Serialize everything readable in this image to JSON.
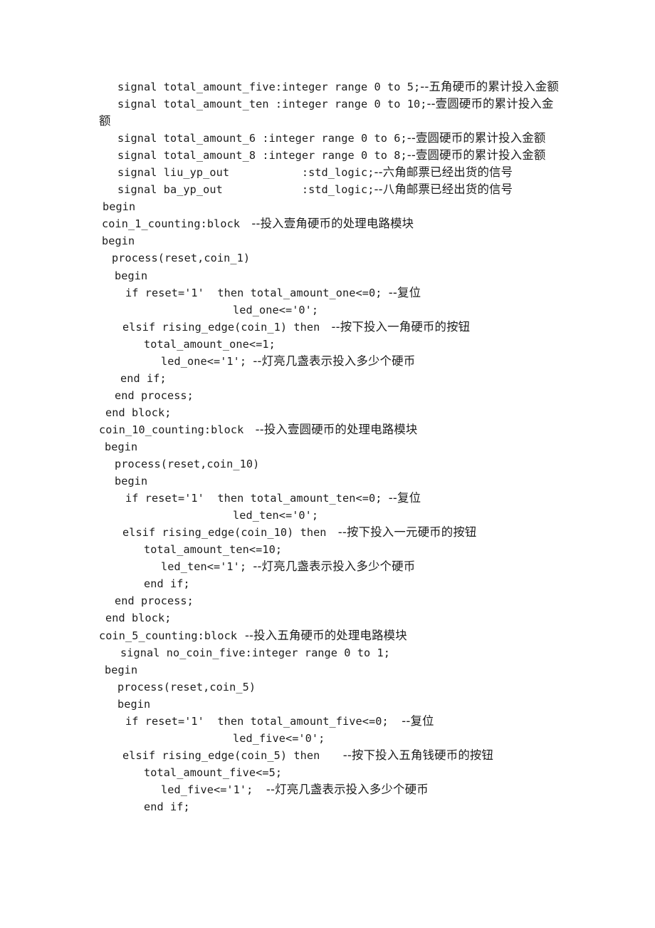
{
  "document": {
    "kind": "vhdl-source-listing",
    "page_background": "#ffffff",
    "text_color": "#1c1c1c",
    "lines": [
      {
        "indent": 26,
        "code": "signal total_amount_five:integer range 0 to 5;",
        "comment": "--五角硬币的累计投入金额"
      },
      {
        "indent": 26,
        "code": "signal total_amount_ten :integer range 0 to 10;",
        "comment": "--壹圆硬币的累计投入金额"
      },
      {
        "indent": 26,
        "code": "signal total_amount_6 :integer range 0 to 6;",
        "comment": "--壹圆硬币的累计投入金额"
      },
      {
        "indent": 26,
        "code": "signal total_amount_8 :integer range 0 to 8;",
        "comment": "--壹圆硬币的累计投入金额"
      },
      {
        "indent": 26,
        "code": "signal liu_yp_out           :std_logic;",
        "comment": "--六角邮票已经出货的信号"
      },
      {
        "indent": 26,
        "code": "signal ba_yp_out            :std_logic;",
        "comment": "--八角邮票已经出货的信号"
      },
      {
        "indent": 5,
        "code": "begin",
        "comment": ""
      },
      {
        "indent": 4,
        "code": "coin_1_counting:block",
        "comment": "   --投入壹角硬币的处理电路模块"
      },
      {
        "indent": 4,
        "code": "begin",
        "comment": ""
      },
      {
        "indent": 18,
        "code": "process(reset,coin_1)",
        "comment": ""
      },
      {
        "indent": 22,
        "code": "begin",
        "comment": ""
      },
      {
        "indent": 37,
        "code": "if reset='1'  then total_amount_one<=0; ",
        "comment": "--复位"
      },
      {
        "indent": 188,
        "code": "led_one<='0';",
        "comment": ""
      },
      {
        "indent": 33,
        "code": "elsif rising_edge(coin_1) then",
        "comment": "   --按下投入一角硬币的按钮"
      },
      {
        "indent": 63,
        "code": "total_amount_one<=1;",
        "comment": ""
      },
      {
        "indent": 87,
        "code": "led_one<='1'; ",
        "comment": "--灯亮几盏表示投入多少个硬币"
      },
      {
        "indent": 30,
        "code": "end if;",
        "comment": ""
      },
      {
        "indent": 22,
        "code": "end process;",
        "comment": ""
      },
      {
        "indent": 9,
        "code": "end block;",
        "comment": ""
      },
      {
        "indent": 0,
        "code": "coin_10_counting:block",
        "comment": "   --投入壹圆硬币的处理电路模块"
      },
      {
        "indent": 8,
        "code": "begin",
        "comment": ""
      },
      {
        "indent": 22,
        "code": "process(reset,coin_10)",
        "comment": ""
      },
      {
        "indent": 22,
        "code": "begin",
        "comment": ""
      },
      {
        "indent": 37,
        "code": "if reset='1'  then total_amount_ten<=0; ",
        "comment": "--复位"
      },
      {
        "indent": 188,
        "code": "led_ten<='0';",
        "comment": ""
      },
      {
        "indent": 33,
        "code": "elsif rising_edge(coin_10) then",
        "comment": "   --按下投入一元硬币的按钮"
      },
      {
        "indent": 63,
        "code": "total_amount_ten<=10;",
        "comment": ""
      },
      {
        "indent": 87,
        "code": "led_ten<='1'; ",
        "comment": "--灯亮几盏表示投入多少个硬币"
      },
      {
        "indent": 63,
        "code": "end if;",
        "comment": ""
      },
      {
        "indent": 22,
        "code": "end process;",
        "comment": ""
      },
      {
        "indent": 9,
        "code": "end block;",
        "comment": ""
      },
      {
        "indent": 0,
        "code": "coin_5_counting:block",
        "comment": "  --投入五角硬币的处理电路模块"
      },
      {
        "indent": 30,
        "code": "signal no_coin_five:integer range 0 to 1;",
        "comment": ""
      },
      {
        "indent": 8,
        "code": "begin",
        "comment": ""
      },
      {
        "indent": 26,
        "code": "process(reset,coin_5)",
        "comment": ""
      },
      {
        "indent": 26,
        "code": "begin",
        "comment": ""
      },
      {
        "indent": 37,
        "code": "if reset='1'  then total_amount_five<=0;  ",
        "comment": "--复位"
      },
      {
        "indent": 188,
        "code": "led_five<='0';",
        "comment": ""
      },
      {
        "indent": 33,
        "code": "elsif rising_edge(coin_5) then",
        "comment": "      --按下投入五角钱硬币的按钮"
      },
      {
        "indent": 63,
        "code": "total_amount_five<=5;",
        "comment": ""
      },
      {
        "indent": 87,
        "code": "led_five<='1';  ",
        "comment": "--灯亮几盏表示投入多少个硬币"
      },
      {
        "indent": 63,
        "code": "end if;",
        "comment": ""
      }
    ]
  }
}
